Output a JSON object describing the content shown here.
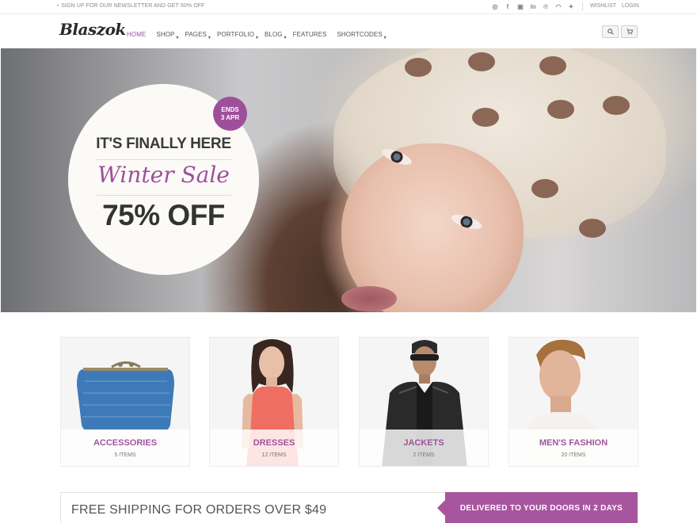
{
  "topbar": {
    "newsletter": "SIGN UP FOR OUR NEWSLETTER AND GET 50% OFF",
    "social_icons": [
      "dribbble-icon",
      "facebook-icon",
      "instagram-icon",
      "linkedin-icon",
      "pinterest-icon",
      "rss-icon",
      "twitter-icon"
    ],
    "wishlist": "WISHLIST",
    "login": "LOGIN"
  },
  "header": {
    "logo": "Blaszok",
    "nav": [
      {
        "label": "HOME",
        "active": true
      },
      {
        "label": "SHOP",
        "dropdown": true
      },
      {
        "label": "PAGES",
        "dropdown": true
      },
      {
        "label": "PORTFOLIO",
        "dropdown": true
      },
      {
        "label": "BLOG",
        "dropdown": true
      },
      {
        "label": "FEATURES"
      },
      {
        "label": "SHORTCODES",
        "dropdown": true
      }
    ],
    "icons": [
      "search-icon",
      "cart-icon"
    ]
  },
  "hero": {
    "badge_line1": "ENDS",
    "badge_line2": "3 APR",
    "headline": "IT'S FINALLY HERE",
    "script_title": "Winter Sale",
    "offer": "75% OFF"
  },
  "categories": [
    {
      "title": "ACCESSORIES",
      "count": "5 ITEMS"
    },
    {
      "title": "DRESSES",
      "count": "12 ITEMS"
    },
    {
      "title": "JACKETS",
      "count": "2 ITEMS"
    },
    {
      "title": "MEN'S FASHION",
      "count": "20 ITEMS"
    }
  ],
  "shipping": {
    "message": "FREE SHIPPING FOR ORDERS OVER $49",
    "tag": "DELIVERED TO YOUR DOORS IN 2 DAYS"
  },
  "colors": {
    "accent": "#a0559b"
  }
}
